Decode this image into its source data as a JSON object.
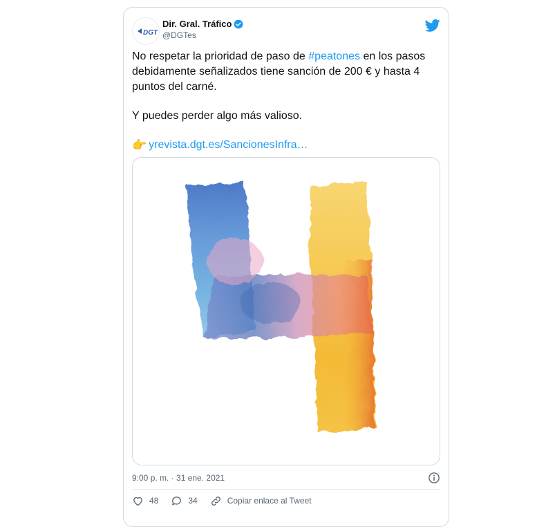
{
  "tweet": {
    "display_name": "Dir. Gral. Tráfico",
    "handle": "@DGTes",
    "avatar_text": "DGT",
    "text_part1": "No respetar la prioridad de paso de ",
    "hashtag": "#peatones",
    "text_part2": " en los pasos debidamente señalizados tiene sanción de 200 € y hasta 4 puntos del carné.",
    "text_second": "Y puedes perder algo más valioso.",
    "link_emoji": "👉",
    "link_text": "yrevista.dgt.es/SancionesInfra…",
    "timestamp": "9:00 p. m. · 31 ene. 2021",
    "likes": "48",
    "replies": "34",
    "copy_link": "Copiar enlace al Tweet"
  },
  "colors": {
    "accent": "#1d9bf0",
    "secondary_text": "#536471",
    "border": "#cfd9de",
    "like": "#536471"
  },
  "icons": [
    "verified-badge-icon",
    "twitter-bird-icon",
    "info-icon",
    "heart-icon",
    "reply-icon",
    "link-icon"
  ]
}
